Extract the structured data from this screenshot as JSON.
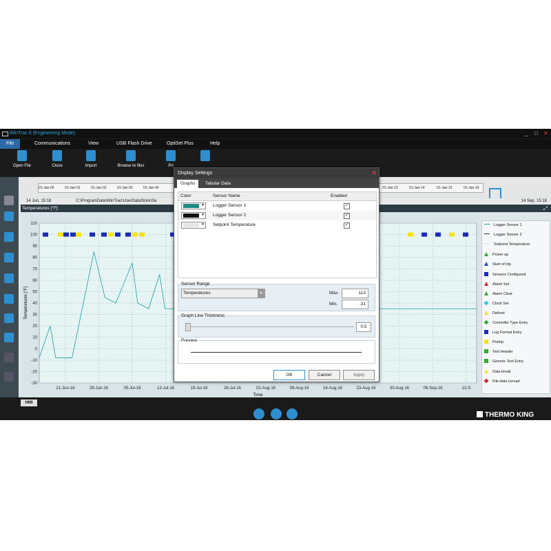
{
  "app": {
    "title": "WinTrac 6 (Engineering Mode)"
  },
  "window_controls": {
    "min": "_",
    "max": "□",
    "close": "✕"
  },
  "menu": [
    "File",
    "Communications",
    "View",
    "USB Flash Drive",
    "OptiSet Plus",
    "Help"
  ],
  "ribbon": [
    "Open File",
    "Close",
    "Import",
    "Browse to files",
    "Pri"
  ],
  "timeline": {
    "start_label": "14 Jun, 15:18",
    "end_label": "14 Sep, 15:18",
    "path": "C:\\ProgramData\\WinTrac\\UserDataStore\\Sa",
    "ticks": [
      "01-Jan-00",
      "01-Jan-01",
      "01-Jan-02",
      "01-Jan-03",
      "01-Jan-04",
      "01-Jan-13",
      "01-Jan-14",
      "01-Jan-15",
      "01-Jan-16"
    ]
  },
  "chart_panel": {
    "title": "Temperatures [°F]"
  },
  "chart_data": {
    "type": "line",
    "xlabel": "Time",
    "ylabel": "Temperatures [°F]",
    "ylim": [
      -30,
      110
    ],
    "yticks": [
      -30,
      -20,
      -10,
      0,
      10,
      20,
      30,
      40,
      50,
      60,
      70,
      80,
      90,
      100,
      110
    ],
    "xticks": [
      "21-Jun-16",
      "28-Jun-16",
      "05-Jul-16",
      "12-Jul-16",
      "19-Jul-16",
      "26-Jul-16",
      "02-Aug-16",
      "09-Aug-16",
      "16-Aug-16",
      "23-Aug-16",
      "30-Aug-16",
      "06-Sep-16",
      "13-S"
    ],
    "grid": true,
    "series": [
      {
        "name": "Logger Sensor 1",
        "color": "#1a9e9e",
        "x": [
          0,
          2,
          3,
          4,
          5,
          6,
          10,
          12,
          14,
          17,
          18,
          20,
          22,
          23,
          26,
          28,
          30,
          32,
          34,
          40,
          42,
          44,
          46,
          48,
          50,
          52,
          55,
          60,
          62,
          64,
          65,
          66,
          68,
          70,
          72,
          74,
          76,
          80
        ],
        "y": [
          -8,
          20,
          -8,
          -8,
          -8,
          -8,
          85,
          45,
          40,
          75,
          40,
          35,
          65,
          35,
          35,
          30,
          72,
          45,
          38,
          30,
          82,
          40,
          -8,
          -8,
          60,
          80,
          45,
          35,
          35,
          35,
          35,
          35,
          35,
          35,
          35,
          35,
          35,
          35
        ]
      }
    ]
  },
  "legend": [
    {
      "label": "Logger Sensor 1",
      "shape": "line",
      "color": "#1a9e9e"
    },
    {
      "label": "Logger Sensor 2",
      "shape": "line",
      "color": "#333333"
    },
    {
      "label": "Setpoint Temperature",
      "shape": "line",
      "color": "#dddddd"
    },
    {
      "label": "Power up",
      "shape": "triangle",
      "color": "#27b327"
    },
    {
      "label": "Start of trip",
      "shape": "triangle",
      "color": "#1a4ad8"
    },
    {
      "label": "Sensors Configured",
      "shape": "square",
      "color": "#1a2ab8"
    },
    {
      "label": "Alarm Set",
      "shape": "triangle",
      "color": "#e02020"
    },
    {
      "label": "Alarm Clear",
      "shape": "triangle",
      "color": "#27b327"
    },
    {
      "label": "Clock Set",
      "shape": "diamond",
      "color": "#1ad0e8"
    },
    {
      "label": "Defrost",
      "shape": "triangle",
      "color": "#f5e21a"
    },
    {
      "label": "Controller Type Entry",
      "shape": "diamond",
      "color": "#27b327"
    },
    {
      "label": "Log Format Entry",
      "shape": "square",
      "color": "#1a2ab8"
    },
    {
      "label": "Pretrip",
      "shape": "square",
      "color": "#f5e21a"
    },
    {
      "label": "Text Header",
      "shape": "square",
      "color": "#27b327"
    },
    {
      "label": "Generic Text Entry",
      "shape": "square",
      "color": "#27b327"
    },
    {
      "label": "Data break",
      "shape": "triangle",
      "color": "#f5e21a"
    },
    {
      "label": "File data corrupt",
      "shape": "diamond",
      "color": "#e02020"
    }
  ],
  "dialog": {
    "title": "Display Settings",
    "close": "✕",
    "tabs": [
      "Graphs",
      "Tabular Data"
    ],
    "columns": [
      "Color",
      "Sensor Name",
      "Enabled"
    ],
    "rows": [
      {
        "color": "#1f8a86",
        "name": "Logger Sensor 1",
        "check": "✓"
      },
      {
        "color": "#111111",
        "name": "Logger Sensor 2",
        "check": "✓"
      },
      {
        "color": "#e5e5e5",
        "name": "Setpoint Temperature",
        "check": "✓"
      }
    ],
    "range": {
      "label": "Sensor Range",
      "select": "Temperatures",
      "max_label": "Max.",
      "max": "113",
      "min_label": "Min.",
      "min": "-31"
    },
    "thickness": {
      "label": "Graph Line Thickness",
      "value": "0.5"
    },
    "preview": {
      "label": "Preview"
    },
    "buttons": {
      "ok": "OK",
      "cancel": "Cancel",
      "apply": "Apply"
    }
  },
  "bottom": {
    "hmi": "HMI",
    "brand": "THERMO KING"
  }
}
